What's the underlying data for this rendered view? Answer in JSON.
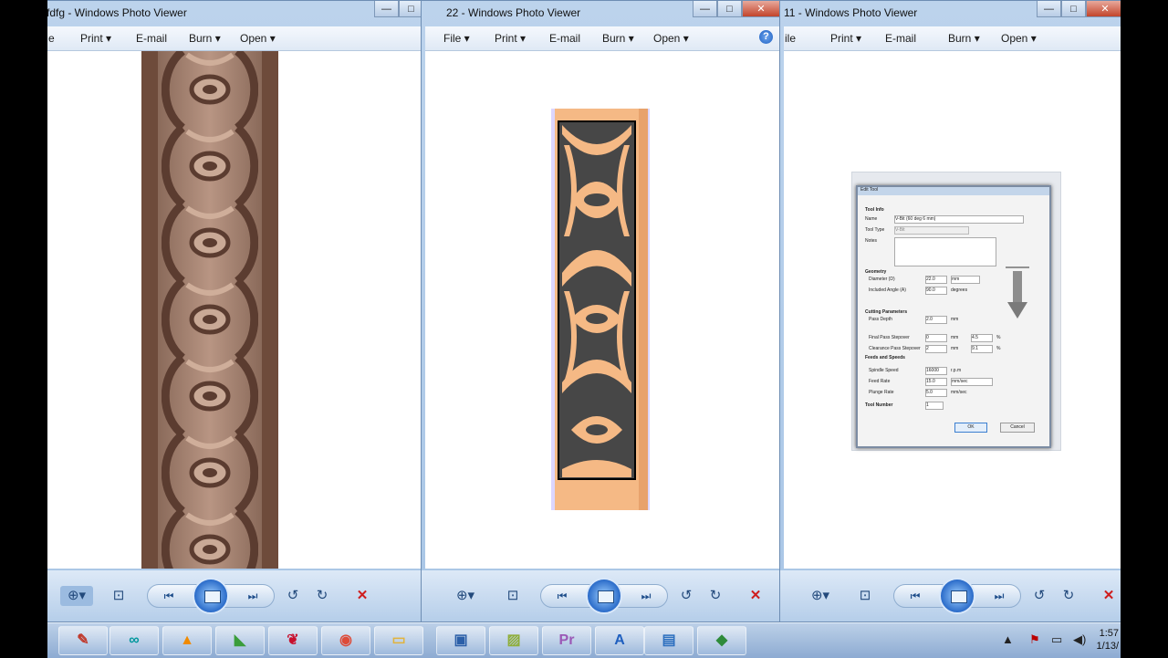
{
  "windows": [
    {
      "title": "fdfg - Windows Photo Viewer",
      "menu": [
        "e",
        "Print",
        "E-mail",
        "Burn",
        "Open"
      ]
    },
    {
      "title": "22 - Windows Photo Viewer",
      "menu": [
        "File",
        "Print",
        "E-mail",
        "Burn",
        "Open"
      ]
    },
    {
      "title": "11 - Windows Photo Viewer",
      "menu": [
        "ile",
        "Print",
        "E-mail",
        "Burn",
        "Open"
      ]
    }
  ],
  "controls": {
    "minimize": "—",
    "maximize": "□",
    "close": "✕"
  },
  "help_glyph": "?",
  "toolbar_glyphs": {
    "zoom": "⊕▾",
    "fit": "⊡",
    "prev": "⏮",
    "next": "⏭",
    "rotate_ccw": "↺",
    "rotate_cw": "↻",
    "delete": "✕"
  },
  "dialog": {
    "title": "Edit Tool",
    "tool_info_header": "Tool Info",
    "name_label": "Name",
    "name_value": "V-Bit (60 deg 6 mm)",
    "tool_type_label": "Tool Type",
    "tool_type_value": "V-Bit",
    "notes_label": "Notes",
    "geometry_header": "Geometry",
    "diameter_label": "Diameter (D)",
    "diameter_value": "22.0",
    "diameter_unit": "mm",
    "angle_label": "Included Angle (A)",
    "angle_value": "90.0",
    "angle_unit": "degrees",
    "cutting_header": "Cutting Parameters",
    "pass_depth_label": "Pass Depth",
    "pass_depth_value": "2.0",
    "pass_depth_unit": "mm",
    "final_stepover_label": "Final Pass Stepover",
    "final_stepover_value": "0",
    "final_stepover_unit": "mm",
    "final_stepover_pct": "4.5",
    "clearance_label": "Clearance Pass Stepover",
    "clearance_value": "2",
    "clearance_unit": "mm",
    "clearance_pct": "9.1",
    "pct_symbol": "%",
    "feeds_header": "Feeds and Speeds",
    "spindle_label": "Spindle Speed",
    "spindle_value": "16000",
    "spindle_unit": "r.p.m",
    "feed_label": "Feed Rate",
    "feed_value": "15.0",
    "feed_unit": "mm/sec",
    "plunge_label": "Plunge Rate",
    "plunge_value": "5.0",
    "plunge_unit": "mm/sec",
    "tool_number_label": "Tool Number",
    "tool_number_value": "1",
    "ok_label": "OK",
    "cancel_label": "Cancel"
  },
  "taskbar": {
    "items": [
      {
        "icon": "paint-icon",
        "glyph": "✎",
        "color": "#c0392b"
      },
      {
        "icon": "arduino-icon",
        "glyph": "∞",
        "color": "#00979c"
      },
      {
        "icon": "vlc-icon",
        "glyph": "▲",
        "color": "#f08a00"
      },
      {
        "icon": "vcarve-icon",
        "glyph": "◣",
        "color": "#3a9d3a"
      },
      {
        "icon": "feather-icon",
        "glyph": "❦",
        "color": "#c8102e"
      },
      {
        "icon": "chrome-icon",
        "glyph": "◉",
        "color": "#dd4b39"
      },
      {
        "icon": "folder-icon",
        "glyph": "▭",
        "color": "#e2b33c"
      },
      {
        "icon": "computer-icon",
        "glyph": "▣",
        "color": "#2b5fa8"
      },
      {
        "icon": "image-icon",
        "glyph": "▨",
        "color": "#8fae3a"
      },
      {
        "icon": "premiere-icon",
        "glyph": "Pr",
        "color": "#9b59b6"
      },
      {
        "icon": "document-icon",
        "glyph": "A",
        "color": "#1f5fbf"
      },
      {
        "icon": "photo-viewer-icon",
        "glyph": "▤",
        "color": "#2c6fbf"
      },
      {
        "icon": "download-icon",
        "glyph": "◆",
        "color": "#2e8b3a"
      }
    ],
    "tray": {
      "chevron": "▲",
      "flag": "⚑",
      "network": "▭",
      "volume": "◀)"
    },
    "time": "1:57",
    "date": "1/13/"
  }
}
